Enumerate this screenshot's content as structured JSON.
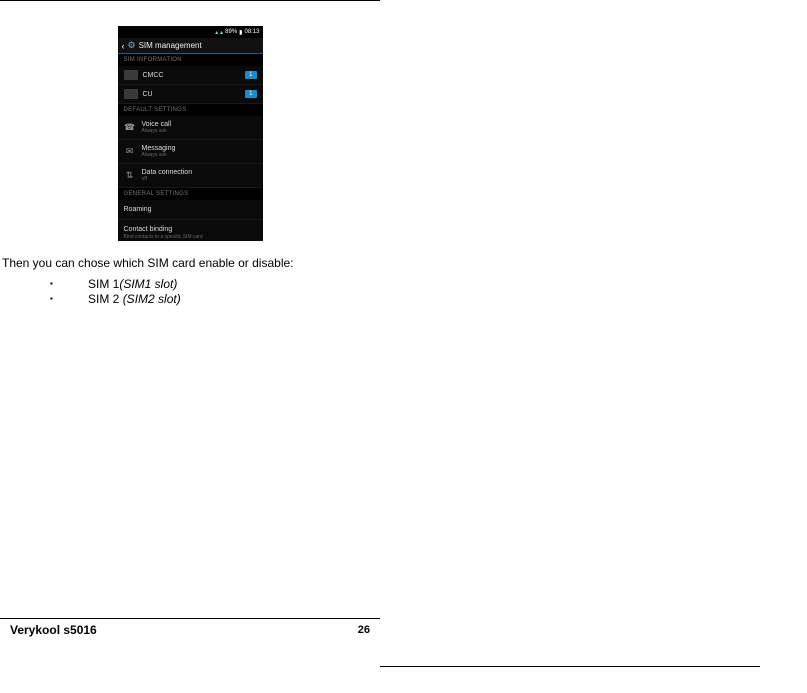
{
  "screenshot": {
    "status": {
      "battery": "89%",
      "time": "08:13"
    },
    "title": "SIM management",
    "sections": {
      "sim_info_header": "SIM INFORMATION",
      "default_header": "DEFAULT SETTINGS",
      "general_header": "GENERAL SETTINGS"
    },
    "sims": [
      {
        "label": "CMCC",
        "badge": "1"
      },
      {
        "label": "CU",
        "badge": "1"
      }
    ],
    "defaults": [
      {
        "title": "Voice call",
        "sub": "Always ask"
      },
      {
        "title": "Messaging",
        "sub": "Always ask"
      },
      {
        "title": "Data connection",
        "sub": "off"
      }
    ],
    "general": [
      {
        "title": "Roaming",
        "sub": ""
      },
      {
        "title": "Contact binding",
        "sub": "Bind contacts to a specific SIM card"
      }
    ]
  },
  "body": {
    "intro": "Then you can chose which SIM card enable or disable:",
    "items": [
      {
        "prefix": "SIM 1",
        "suffix": "(SIM1 slot)"
      },
      {
        "prefix": "SIM 2 ",
        "suffix": "(SIM2 slot)"
      }
    ]
  },
  "footer": {
    "model": "Verykool s5016",
    "page": "26"
  }
}
